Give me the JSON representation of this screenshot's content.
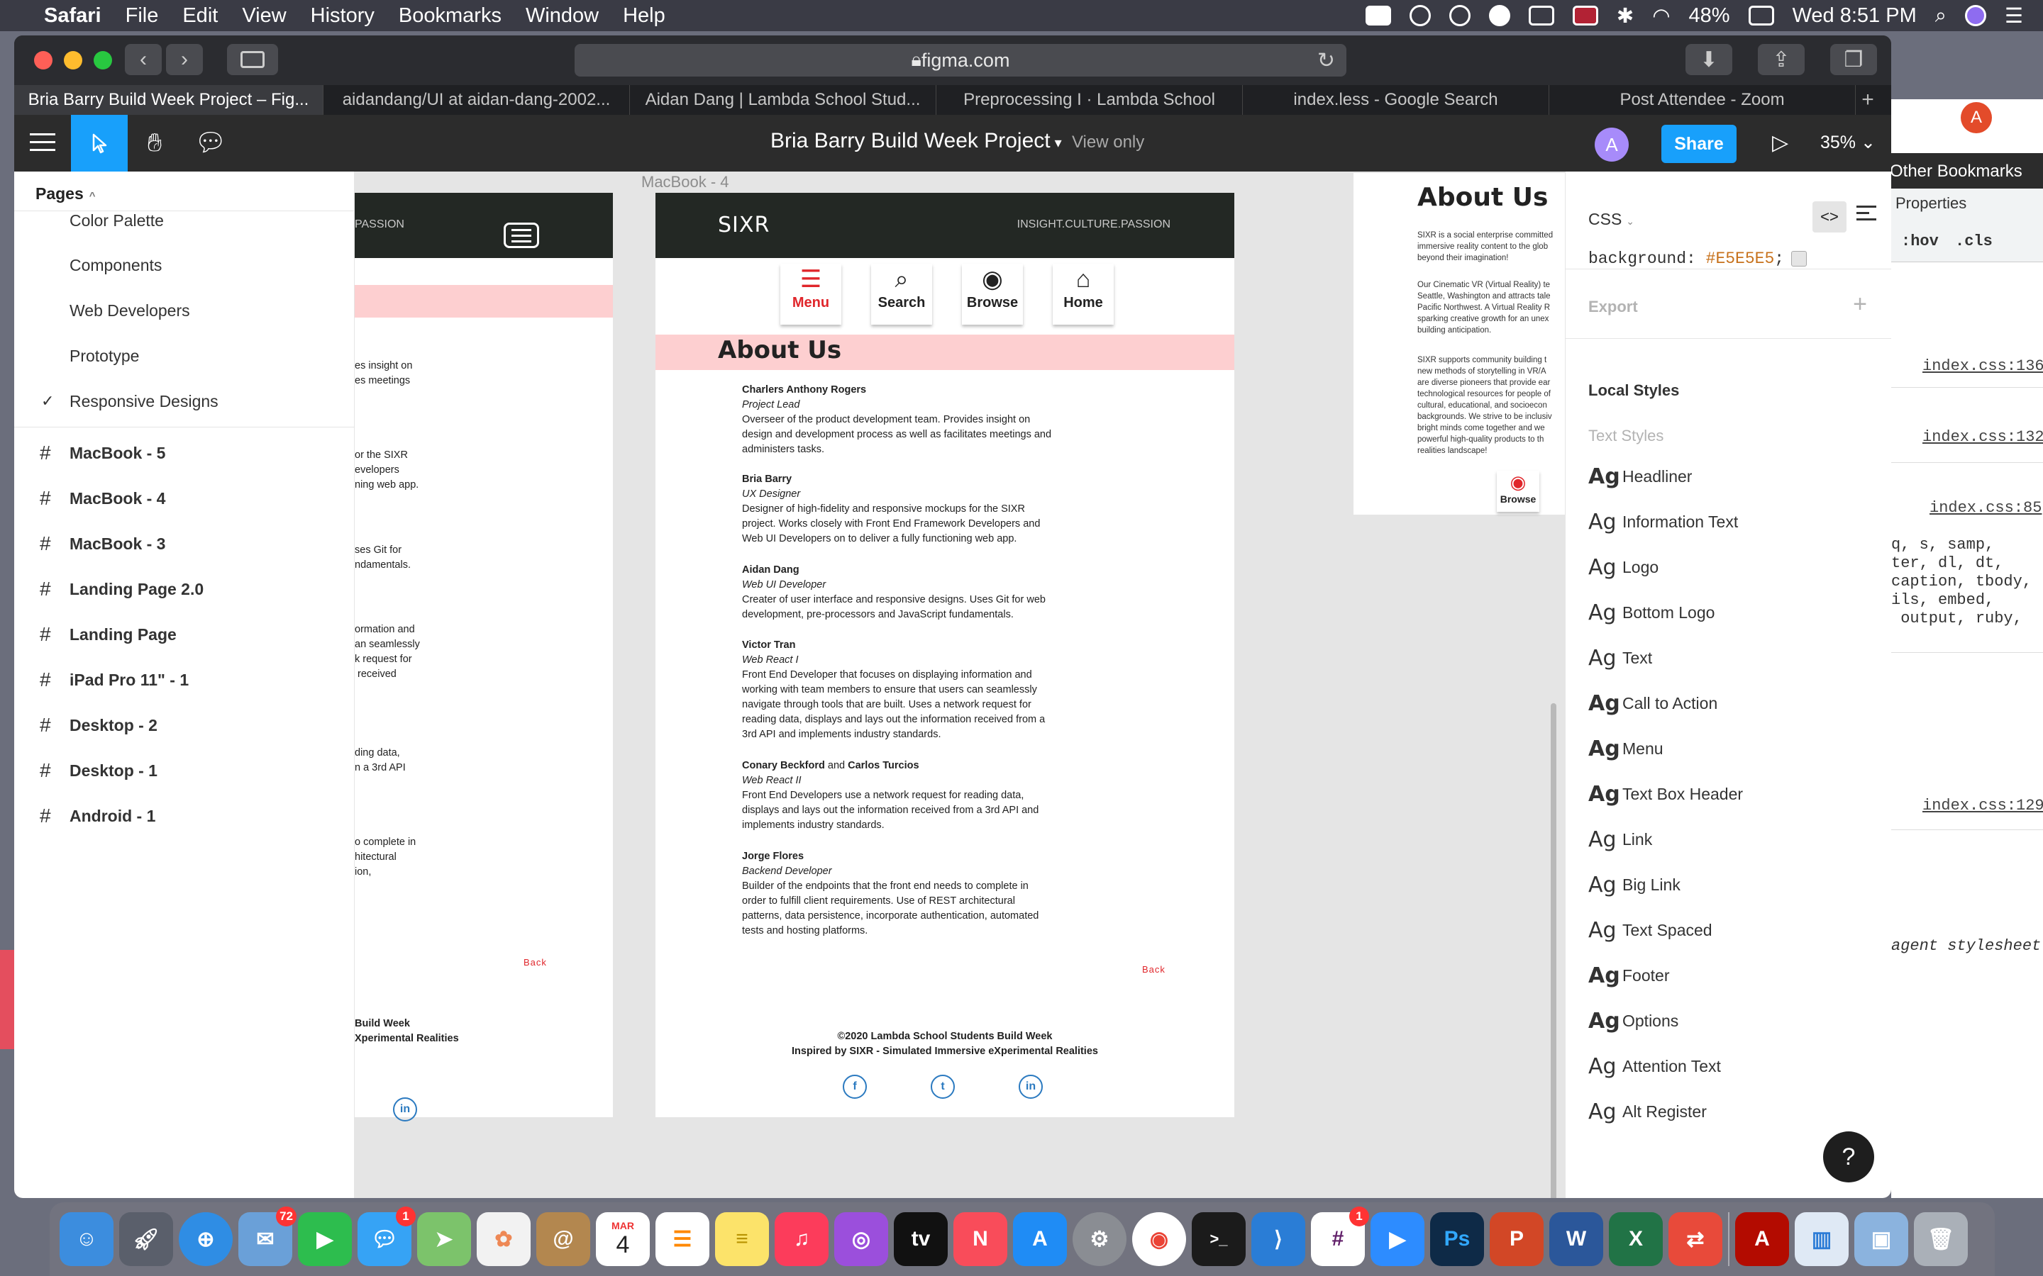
{
  "menubar": {
    "app": "Safari",
    "items": [
      "File",
      "Edit",
      "View",
      "History",
      "Bookmarks",
      "Window",
      "Help"
    ],
    "battery": "48%",
    "clock": "Wed 8:51 PM"
  },
  "browser": {
    "url": "figma.com",
    "tabs": [
      "Bria Barry Build Week Project – Fig...",
      "aidandang/UI at aidan-dang-2002...",
      "Aidan Dang | Lambda School Stud...",
      "Preprocessing I · Lambda School",
      "index.less - Google Search",
      "Post Attendee - Zoom"
    ],
    "other_bookmarks": "Other Bookmarks"
  },
  "figma": {
    "file_title": "Bria Barry Build Week Project",
    "view_mode": "View only",
    "avatar": "A",
    "share": "Share",
    "zoom": "35%"
  },
  "pages_panel": {
    "header": "Pages",
    "pages": [
      "Color Palette",
      "Components",
      "Web Developers",
      "Prototype",
      "Responsive Designs"
    ],
    "frames": [
      "MacBook - 5",
      "MacBook - 4",
      "MacBook - 3",
      "Landing Page 2.0",
      "Landing Page",
      "iPad Pro 11\" - 1",
      "Desktop - 2",
      "Desktop - 1",
      "Android - 1"
    ]
  },
  "canvas": {
    "frame_label": "MacBook - 4",
    "logo": "SIXR",
    "tagline": "INSIGHT.CULTURE.PASSION",
    "tagline_clip": "PASSION",
    "nav": [
      "Menu",
      "Search",
      "Browse",
      "Home"
    ],
    "about_title": "About Us",
    "members": [
      {
        "name": "Charlers Anthony Rogers",
        "role": "Project Lead",
        "desc": "Overseer of the product development team. Provides insight on design and development process as well as facilitates meetings and administers tasks."
      },
      {
        "name": "Bria Barry",
        "role": "UX Designer",
        "desc": "Designer of high-fidelity and responsive mockups for the SIXR project. Works closely with Front End Framework Developers and Web UI Developers on to deliver a fully functioning web app."
      },
      {
        "name": "Aidan Dang",
        "role": "Web UI Developer",
        "desc": "Creater of user interface and responsive designs.  Uses Git for web development, pre-processors and JavaScript fundamentals."
      },
      {
        "name": "Victor Tran",
        "role": "Web React I",
        "desc": "Front End Developer that focuses on displaying information and working with team members to ensure that users can seamlessly navigate through tools that are built. Uses a network request for reading data, displays and lays out the information received from a 3rd API and implements industry standards."
      },
      {
        "name": "Conary Beckford",
        "name_join": "and",
        "name2": "Carlos Turcios",
        "role": "Web React II",
        "desc": "Front End Developers use a network request for reading data, displays and lays out the information received from a 3rd API and implements industry standards."
      },
      {
        "name": "Jorge Flores",
        "role": "Backend Developer",
        "desc": "Builder of the endpoints that the front end needs to complete in order to fulfill client requirements.  Use of REST architectural patterns, data persistence, incorporate authentication, automated tests and hosting platforms."
      }
    ],
    "back": "Back",
    "footer_line1": "©2020 Lambda School Students Build Week",
    "footer_line2": "Inspired by SIXR - Simulated Immersive eXperimental Realities",
    "left_clip": [
      "es insight on\nes meetings",
      "or the SIXR\nevelopers\nning web app.",
      "ses Git for\nndamentals.",
      "ormation and\nan seamlessly\nk request for\n received",
      "ding data,\nn a 3rd API",
      "o complete in\nhitectural\nion,",
      "Build Week\nXperimental Realities"
    ],
    "right_frame": {
      "title": "About Us",
      "p1": "SIXR is a social enterprise committed\nimmersive reality content to the glob\nbeyond their imagination!",
      "p2": "Our Cinematic VR (Virtual Reality) te\nSeattle, Washington and attracts tale\nPacific Northwest. A Virtual Reality R\nsparking creative growth for an unex\nbuilding anticipation.",
      "p3": "SIXR supports community building t\nnew methods of storytelling in VR/A\nare diverse pioneers that provide ear\ntechnological resources for people of\ncultural, educational, and socioecon\nbackgrounds. We strive to be inclusiv\nbright minds come together and we\npowerful high-quality products to th\nrealities landscape!",
      "browse": "Browse"
    }
  },
  "inspector": {
    "mode": "CSS",
    "css_prop": "background:",
    "css_value": "#E5E5E5",
    "export": "Export",
    "local_styles": "Local Styles",
    "text_styles": "Text Styles",
    "styles": [
      "Headliner",
      "Information Text",
      "Logo",
      "Bottom Logo",
      "Text",
      "Call to Action",
      "Menu",
      "Text Box Header",
      "Link",
      "Big Link",
      "Text Spaced",
      "Footer",
      "Options",
      "Attention Text",
      "Alt Register"
    ],
    "help": "?"
  },
  "devtools": {
    "properties": "Properties",
    "hov": ":hov",
    "cls": ".cls",
    "links": [
      "index.css:136",
      "index.css:132",
      "index.css:85",
      "index.css:129"
    ],
    "selector_text": "q, s, samp,\nter, dl, dt,\ncaption, tbody,\nils, embed,\n output, ruby,",
    "agent": "agent stylesheet"
  },
  "dock": {
    "badges": {
      "mail": "72",
      "messages": "1",
      "slack": "1"
    },
    "calendar_month": "MAR",
    "calendar_day": "4"
  },
  "colors": {
    "figma_blue": "#18a0fb",
    "site_header": "#232824",
    "pink_band": "#fdcfd0",
    "accent_red": "#e0262b",
    "canvas_bg": "#e5e5e5"
  }
}
